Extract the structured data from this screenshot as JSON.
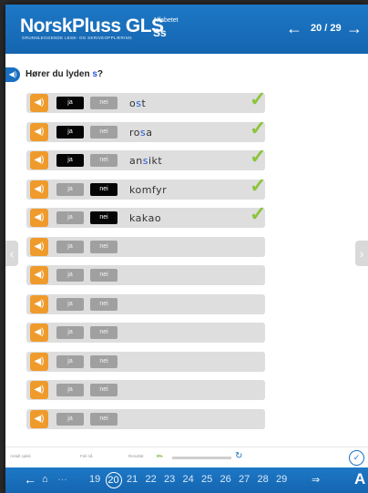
{
  "header": {
    "logo": "NorskPluss GLS",
    "logo_sub": "GRUNNLEGGENDE LESE- OG SKRIVEOPPLÆRING",
    "section": "Alfabetet",
    "letter": "Ss",
    "page": "20 / 29",
    "prev_icon": "arrow-left-icon",
    "next_icon": "arrow-right-icon"
  },
  "question": {
    "prefix": "Hører du lyden ",
    "letter": "s",
    "suffix": "?"
  },
  "buttons": {
    "ja": "ja",
    "nei": "nei"
  },
  "rows": [
    {
      "answer": "ja",
      "pre": "o",
      "hl": "s",
      "post": "t",
      "correct": true
    },
    {
      "answer": "ja",
      "pre": "ro",
      "hl": "s",
      "post": "a",
      "correct": true
    },
    {
      "answer": "ja",
      "pre": "an",
      "hl": "s",
      "post": "ikt",
      "correct": true
    },
    {
      "answer": "nei",
      "pre": "komfyr",
      "hl": "",
      "post": "",
      "correct": true
    },
    {
      "answer": "nei",
      "pre": "kakao",
      "hl": "",
      "post": "",
      "correct": true
    },
    {
      "answer": null
    },
    {
      "answer": null
    },
    {
      "answer": null
    },
    {
      "answer": null
    },
    {
      "answer": null
    },
    {
      "answer": null
    },
    {
      "answer": null
    }
  ],
  "footer": {
    "attempts_label": "Antall sjekk",
    "errors_label": "Feil nå",
    "result_label": "Resultat",
    "result_value": "0%",
    "progress": 0
  },
  "pages": [
    "19",
    "20",
    "21",
    "22",
    "23",
    "24",
    "25",
    "26",
    "27",
    "28",
    "29"
  ],
  "current_page": "20",
  "font_button": "A",
  "colors": {
    "brand": "#1565b0",
    "speaker": "#ef9b2c",
    "check": "#8cc43c",
    "highlight": "#2457d6"
  }
}
